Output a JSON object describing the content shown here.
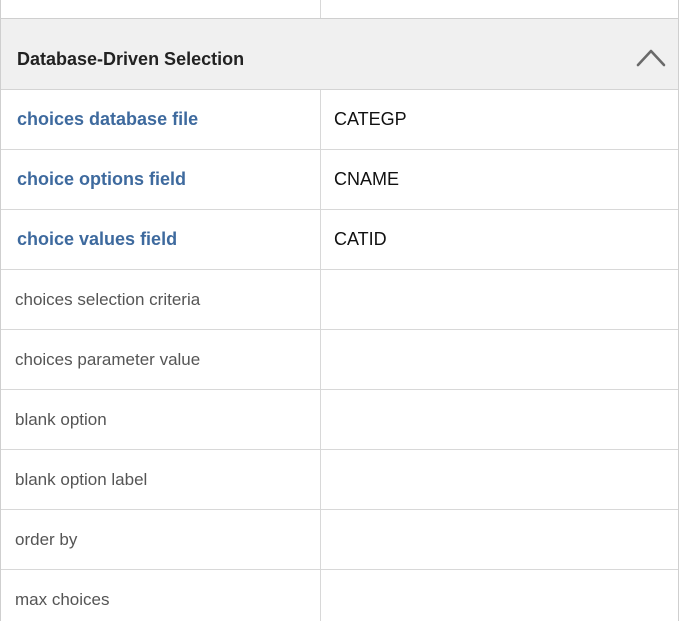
{
  "section": {
    "title": "Database-Driven Selection",
    "collapse_icon": "chevron-up-icon"
  },
  "colors": {
    "header_bg": "#f0f0f0",
    "set_label": "#3e6a9e",
    "unset_label": "#555555",
    "grid_line": "#d8d8d8"
  },
  "properties": [
    {
      "label": "choices database file",
      "value": "CATEGP",
      "set": true
    },
    {
      "label": "choice options field",
      "value": "CNAME",
      "set": true
    },
    {
      "label": "choice values field",
      "value": "CATID",
      "set": true
    },
    {
      "label": "choices selection criteria",
      "value": "",
      "set": false
    },
    {
      "label": "choices parameter value",
      "value": "",
      "set": false
    },
    {
      "label": "blank option",
      "value": "",
      "set": false
    },
    {
      "label": "blank option label",
      "value": "",
      "set": false
    },
    {
      "label": "order by",
      "value": "",
      "set": false
    },
    {
      "label": "max choices",
      "value": "",
      "set": false
    }
  ]
}
